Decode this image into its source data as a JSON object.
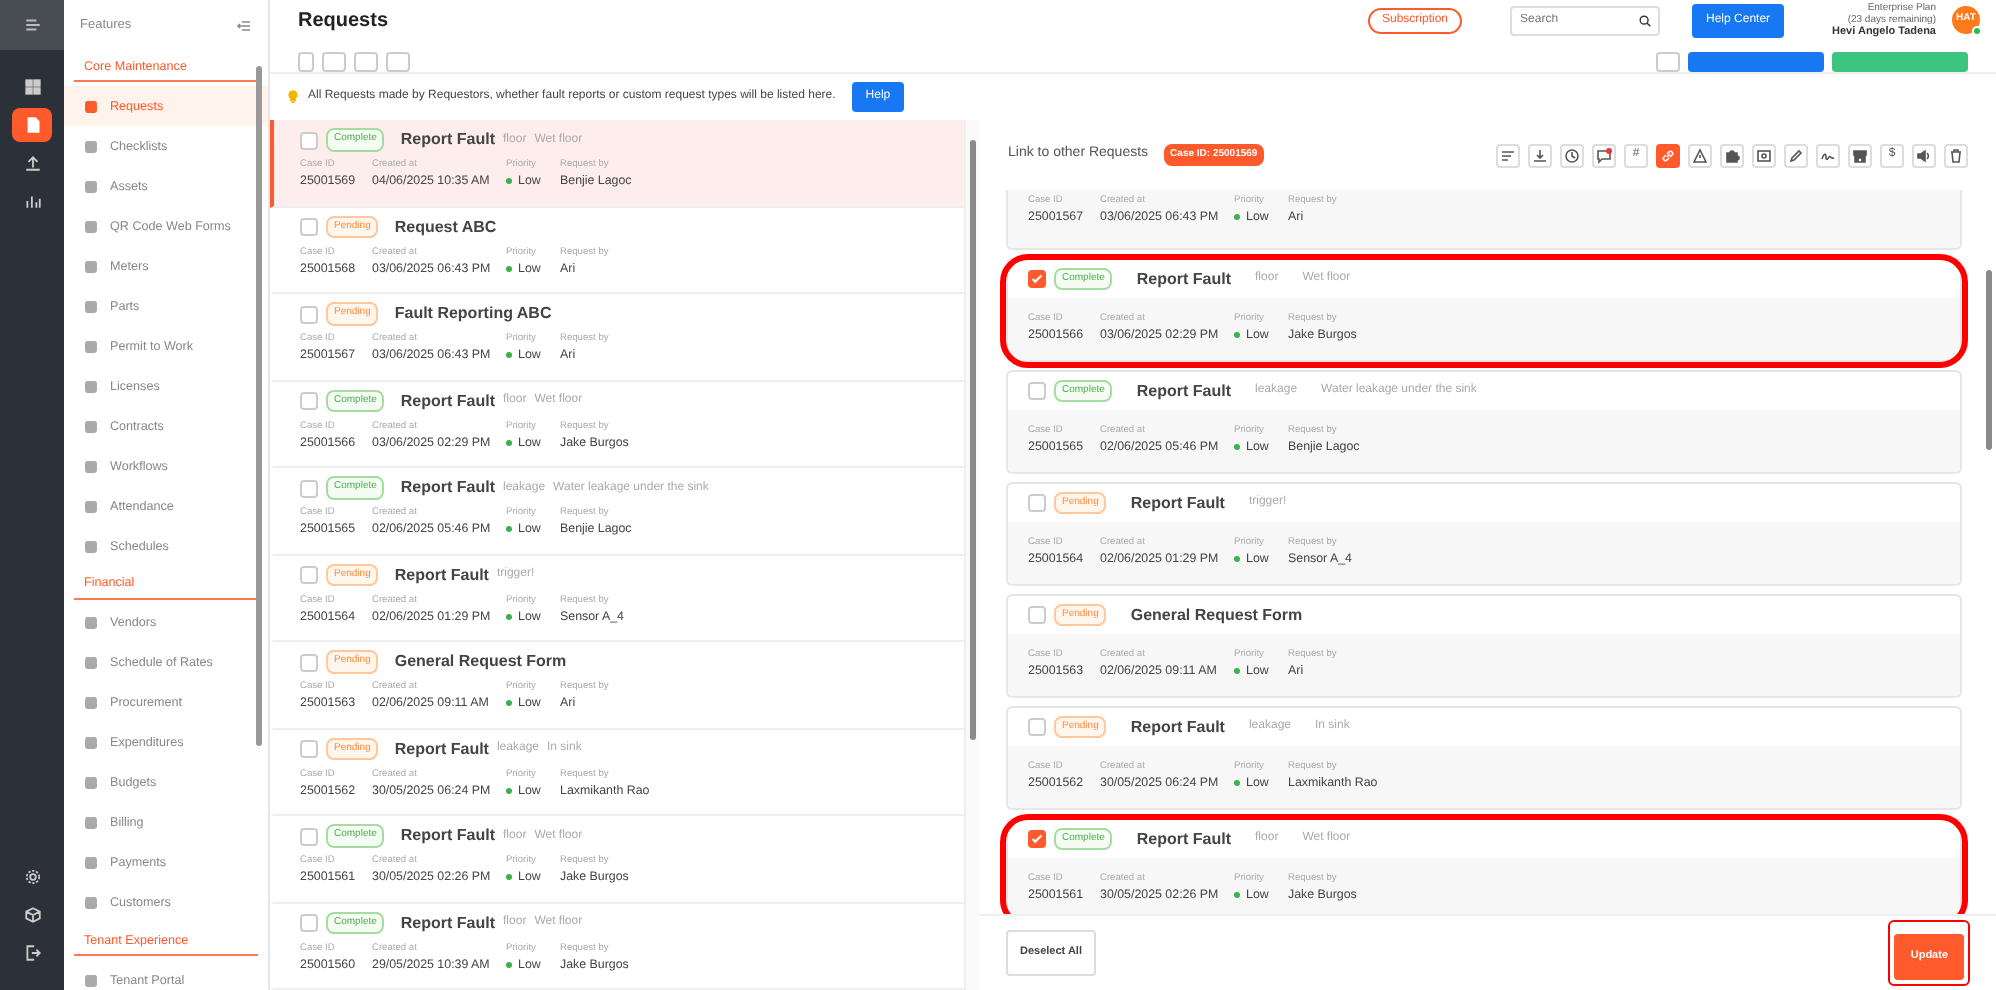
{
  "rail": {
    "items": [
      {
        "selected": false
      },
      {
        "selected": true
      },
      {
        "selected": false
      },
      {
        "selected": false
      }
    ]
  },
  "sidebar": {
    "title": "Features",
    "sections": [
      {
        "heading": "Core Maintenance",
        "items": [
          {
            "label": "Requests",
            "selected": true
          },
          {
            "label": "Checklists",
            "selected": false
          },
          {
            "label": "Assets",
            "selected": false
          },
          {
            "label": "QR Code Web Forms",
            "selected": false
          },
          {
            "label": "Meters",
            "selected": false
          },
          {
            "label": "Parts",
            "selected": false
          },
          {
            "label": "Permit to Work",
            "selected": false
          },
          {
            "label": "Licenses",
            "selected": false
          },
          {
            "label": "Contracts",
            "selected": false
          },
          {
            "label": "Workflows",
            "selected": false
          },
          {
            "label": "Attendance",
            "selected": false
          },
          {
            "label": "Schedules",
            "selected": false
          }
        ]
      },
      {
        "heading": "Financial",
        "items": [
          {
            "label": "Vendors",
            "selected": false
          },
          {
            "label": "Schedule of Rates",
            "selected": false
          },
          {
            "label": "Procurement",
            "selected": false
          },
          {
            "label": "Expenditures",
            "selected": false
          },
          {
            "label": "Budgets",
            "selected": false
          },
          {
            "label": "Billing",
            "selected": false
          },
          {
            "label": "Payments",
            "selected": false
          },
          {
            "label": "Customers",
            "selected": false
          }
        ]
      },
      {
        "heading": "Tenant Experience",
        "items": [
          {
            "label": "Tenant Portal",
            "selected": false
          }
        ]
      }
    ]
  },
  "header": {
    "title": "Requests",
    "subscription": "Subscription",
    "search": {
      "placeholder": "Search"
    },
    "help_center": "Help Center",
    "plan": "Enterprise Plan",
    "remaining": "(23 days remaining)",
    "user": "Hevi Angelo Tadena",
    "avatar": "HAT",
    "online": true
  },
  "info": {
    "text": "All Requests made by Requestors, whether fault reports or custom request types will be listed here.",
    "button": "Help"
  },
  "requests": [
    {
      "selected": true,
      "checked": false,
      "status": {
        "label": "Complete",
        "kind": "complete"
      },
      "title": "Report Fault",
      "category": "floor",
      "description": "Wet floor",
      "labels": [
        "Case ID",
        "Created at",
        "Priority",
        "Request by"
      ],
      "case_id": "25001569",
      "created_at": "04/06/2025 10:35 AM",
      "priority": "Low",
      "requested_by": "Benjie Lagoc"
    },
    {
      "selected": false,
      "checked": false,
      "status": {
        "label": "Pending",
        "kind": "pending"
      },
      "title": "Request ABC",
      "labels": [
        "Case ID",
        "Created at",
        "Priority",
        "Request by"
      ],
      "case_id": "25001568",
      "created_at": "03/06/2025 06:43 PM",
      "priority": "Low",
      "requested_by": "Ari"
    },
    {
      "selected": false,
      "checked": false,
      "status": {
        "label": "Pending",
        "kind": "pending"
      },
      "title": "Fault Reporting ABC",
      "labels": [
        "Case ID",
        "Created at",
        "Priority",
        "Request by"
      ],
      "case_id": "25001567",
      "created_at": "03/06/2025 06:43 PM",
      "priority": "Low",
      "requested_by": "Ari"
    },
    {
      "selected": false,
      "checked": false,
      "status": {
        "label": "Complete",
        "kind": "complete"
      },
      "title": "Report Fault",
      "category": "floor",
      "description": "Wet floor",
      "labels": [
        "Case ID",
        "Created at",
        "Priority",
        "Request by"
      ],
      "case_id": "25001566",
      "created_at": "03/06/2025 02:29 PM",
      "priority": "Low",
      "requested_by": "Jake Burgos"
    },
    {
      "selected": false,
      "checked": false,
      "status": {
        "label": "Complete",
        "kind": "complete"
      },
      "title": "Report Fault",
      "category": "leakage",
      "description": "Water leakage under the sink",
      "labels": [
        "Case ID",
        "Created at",
        "Priority",
        "Request by"
      ],
      "case_id": "25001565",
      "created_at": "02/06/2025 05:46 PM",
      "priority": "Low",
      "requested_by": "Benjie Lagoc"
    },
    {
      "selected": false,
      "checked": false,
      "status": {
        "label": "Pending",
        "kind": "pending"
      },
      "title": "Report Fault",
      "category": "trigger!",
      "labels": [
        "Case ID",
        "Created at",
        "Priority",
        "Request by"
      ],
      "case_id": "25001564",
      "created_at": "02/06/2025 01:29 PM",
      "priority": "Low",
      "requested_by": "Sensor A_4"
    },
    {
      "selected": false,
      "checked": false,
      "status": {
        "label": "Pending",
        "kind": "pending"
      },
      "title": "General Request Form",
      "labels": [
        "Case ID",
        "Created at",
        "Priority",
        "Request by"
      ],
      "case_id": "25001563",
      "created_at": "02/06/2025 09:11 AM",
      "priority": "Low",
      "requested_by": "Ari"
    },
    {
      "selected": false,
      "checked": false,
      "status": {
        "label": "Pending",
        "kind": "pending"
      },
      "title": "Report Fault",
      "category": "leakage",
      "description": "In sink",
      "labels": [
        "Case ID",
        "Created at",
        "Priority",
        "Request by"
      ],
      "case_id": "25001562",
      "created_at": "30/05/2025 06:24 PM",
      "priority": "Low",
      "requested_by": "Laxmikanth Rao"
    },
    {
      "selected": false,
      "checked": false,
      "status": {
        "label": "Complete",
        "kind": "complete"
      },
      "title": "Report Fault",
      "category": "floor",
      "description": "Wet floor",
      "labels": [
        "Case ID",
        "Created at",
        "Priority",
        "Request by"
      ],
      "case_id": "25001561",
      "created_at": "30/05/2025 02:26 PM",
      "priority": "Low",
      "requested_by": "Jake Burgos"
    },
    {
      "selected": false,
      "checked": false,
      "status": {
        "label": "Complete",
        "kind": "complete"
      },
      "title": "Report Fault",
      "category": "floor",
      "description": "Wet floor",
      "labels": [
        "Case ID",
        "Created at",
        "Priority",
        "Request by"
      ],
      "case_id": "25001560",
      "created_at": "29/05/2025 10:39 AM",
      "priority": "Low",
      "requested_by": "Jake Burgos"
    }
  ],
  "panel": {
    "title": "Link to other Requests",
    "case_badge": "Case ID: 25001569",
    "tools": [
      {
        "kind": "icon",
        "selected": false
      },
      {
        "kind": "icon",
        "selected": false
      },
      {
        "kind": "icon",
        "selected": false
      },
      {
        "kind": "icon",
        "selected": false,
        "dot": true
      },
      {
        "kind": "glyph",
        "label": "#",
        "selected": false
      },
      {
        "kind": "icon",
        "selected": true
      },
      {
        "kind": "icon",
        "selected": false
      },
      {
        "kind": "icon",
        "selected": false
      },
      {
        "kind": "icon",
        "selected": false
      },
      {
        "kind": "icon",
        "selected": false
      },
      {
        "kind": "icon",
        "selected": false
      },
      {
        "kind": "icon",
        "selected": false
      },
      {
        "kind": "glyph",
        "label": "$",
        "selected": false
      },
      {
        "kind": "icon",
        "selected": false
      },
      {
        "kind": "icon",
        "selected": false
      }
    ],
    "related": [
      {
        "kind": "cut",
        "labels": [
          "Case ID",
          "Created at",
          "Priority",
          "Request by"
        ],
        "case_id": "25001567",
        "created_at": "03/06/2025 06:43 PM",
        "priority": "Low",
        "requested_by": "Ari"
      },
      {
        "kind": "full",
        "checked": true,
        "circled": true,
        "status": {
          "label": "Complete",
          "kind": "complete"
        },
        "title": "Report Fault",
        "category": "floor",
        "description": "Wet floor",
        "labels": [
          "Case ID",
          "Created at",
          "Priority",
          "Request by"
        ],
        "case_id": "25001566",
        "created_at": "03/06/2025 02:29 PM",
        "priority": "Low",
        "requested_by": "Jake Burgos"
      },
      {
        "kind": "full",
        "checked": false,
        "circled": false,
        "status": {
          "label": "Complete",
          "kind": "complete"
        },
        "title": "Report Fault",
        "category": "leakage",
        "description": "Water leakage under the sink",
        "labels": [
          "Case ID",
          "Created at",
          "Priority",
          "Request by"
        ],
        "case_id": "25001565",
        "created_at": "02/06/2025 05:46 PM",
        "priority": "Low",
        "requested_by": "Benjie Lagoc"
      },
      {
        "kind": "full",
        "checked": false,
        "circled": false,
        "status": {
          "label": "Pending",
          "kind": "pending"
        },
        "title": "Report Fault",
        "category": "trigger!",
        "labels": [
          "Case ID",
          "Created at",
          "Priority",
          "Request by"
        ],
        "case_id": "25001564",
        "created_at": "02/06/2025 01:29 PM",
        "priority": "Low",
        "requested_by": "Sensor A_4"
      },
      {
        "kind": "full",
        "checked": false,
        "circled": false,
        "status": {
          "label": "Pending",
          "kind": "pending"
        },
        "title": "General Request Form",
        "labels": [
          "Case ID",
          "Created at",
          "Priority",
          "Request by"
        ],
        "case_id": "25001563",
        "created_at": "02/06/2025 09:11 AM",
        "priority": "Low",
        "requested_by": "Ari"
      },
      {
        "kind": "full",
        "checked": false,
        "circled": false,
        "status": {
          "label": "Pending",
          "kind": "pending"
        },
        "title": "Report Fault",
        "category": "leakage",
        "description": "In sink",
        "labels": [
          "Case ID",
          "Created at",
          "Priority",
          "Request by"
        ],
        "case_id": "25001562",
        "created_at": "30/05/2025 06:24 PM",
        "priority": "Low",
        "requested_by": "Laxmikanth Rao"
      },
      {
        "kind": "full",
        "checked": true,
        "circled": true,
        "status": {
          "label": "Complete",
          "kind": "complete"
        },
        "title": "Report Fault",
        "category": "floor",
        "description": "Wet floor",
        "labels": [
          "Case ID",
          "Created at",
          "Priority",
          "Request by"
        ],
        "case_id": "25001561",
        "created_at": "30/05/2025 02:26 PM",
        "priority": "Low",
        "requested_by": "Jake Burgos"
      }
    ],
    "deselect": "Deselect All",
    "update": {
      "label": "Update",
      "circled": true
    }
  }
}
